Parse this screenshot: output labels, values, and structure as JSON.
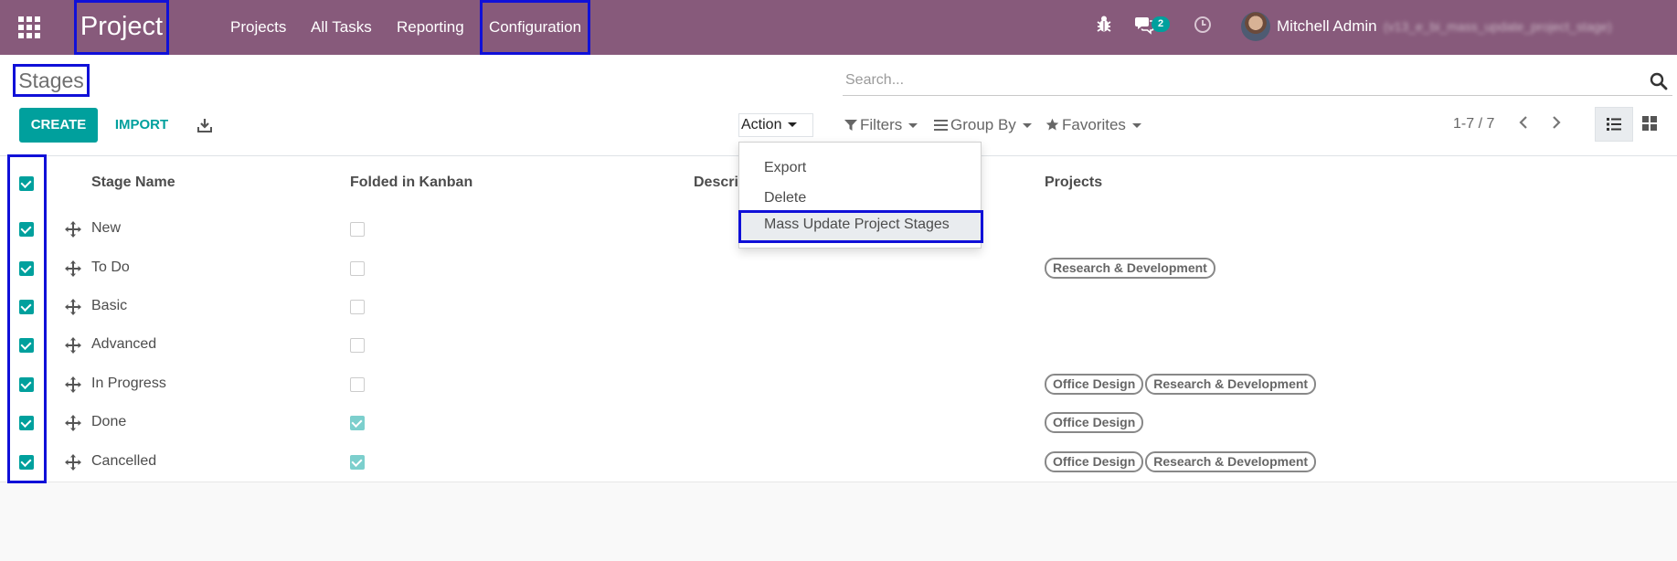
{
  "navbar": {
    "app_name": "Project",
    "menu": [
      "Projects",
      "All Tasks",
      "Reporting",
      "Configuration"
    ],
    "message_count": "2",
    "user_name": "Mitchell Admin",
    "database": "(v13_e_bi_mass_update_project_stage)",
    "icons": [
      "apps-icon",
      "bug-icon",
      "chat-icon",
      "clock-icon"
    ]
  },
  "control_panel": {
    "breadcrumb": "Stages",
    "search_placeholder": "Search...",
    "create_label": "CREATE",
    "import_label": "IMPORT",
    "action_label": "Action",
    "filters_label": "Filters",
    "group_by_label": "Group By",
    "favorites_label": "Favorites",
    "pager": "1-7 / 7",
    "active_view": "list"
  },
  "action_menu": {
    "items": [
      "Export",
      "Delete",
      "Mass Update Project Stages"
    ],
    "highlighted": "Mass Update Project Stages"
  },
  "table": {
    "columns": [
      "Stage Name",
      "Folded in Kanban",
      "Description",
      "Projects"
    ],
    "column_visible_text": [
      "Stage Name",
      "Folded in Kanban",
      "Descri",
      "Projects"
    ],
    "select_all_checked": true,
    "rows": [
      {
        "name": "New",
        "selected": true,
        "folded": false,
        "projects": []
      },
      {
        "name": "To Do",
        "selected": true,
        "folded": false,
        "projects": [
          "Research & Development"
        ]
      },
      {
        "name": "Basic",
        "selected": true,
        "folded": false,
        "projects": []
      },
      {
        "name": "Advanced",
        "selected": true,
        "folded": false,
        "projects": []
      },
      {
        "name": "In Progress",
        "selected": true,
        "folded": false,
        "projects": [
          "Office Design",
          "Research & Development"
        ]
      },
      {
        "name": "Done",
        "selected": true,
        "folded": true,
        "projects": [
          "Office Design"
        ]
      },
      {
        "name": "Cancelled",
        "selected": true,
        "folded": true,
        "projects": [
          "Office Design",
          "Research & Development"
        ]
      }
    ]
  },
  "colors": {
    "navbar": "#875a7b",
    "primary": "#00a09d",
    "highlight_box": "#1010d8"
  }
}
